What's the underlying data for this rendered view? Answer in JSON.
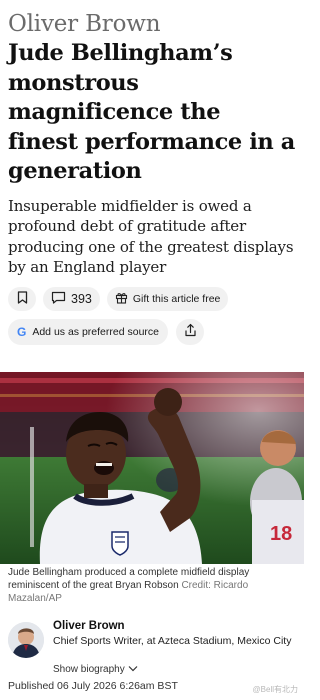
{
  "article": {
    "kicker": "Oliver Brown",
    "headline": "Jude Bellingham’s monstrous magnificence the finest performance in a generation",
    "standfirst": "Insuperable midfielder is owed a profound debt of gratitude after producing one of the greatest displays by an England player"
  },
  "actions": {
    "bookmark_icon": "bookmark-icon",
    "comments_icon": "comment-icon",
    "comments_count": "393",
    "gift_icon": "gift-icon",
    "gift_label": "Gift this article free",
    "google_mark": "G",
    "google_label": "Add us as preferred source",
    "share_icon": "share-icon"
  },
  "image": {
    "caption": "Jude Bellingham produced a complete midfield display reminiscent of the great Bryan Robson",
    "credit": "Credit: Ricardo Mazalan/AP",
    "shirt_number": "18"
  },
  "byline": {
    "name": "Oliver Brown",
    "role": "Chief Sports Writer, at Azteca Stadium, Mexico City",
    "bio_toggle": "Show biography",
    "bio_icon": "chevron-down-icon"
  },
  "published": "Published 06 July 2026 6:26am BST",
  "watermark": "@Bell有北力"
}
